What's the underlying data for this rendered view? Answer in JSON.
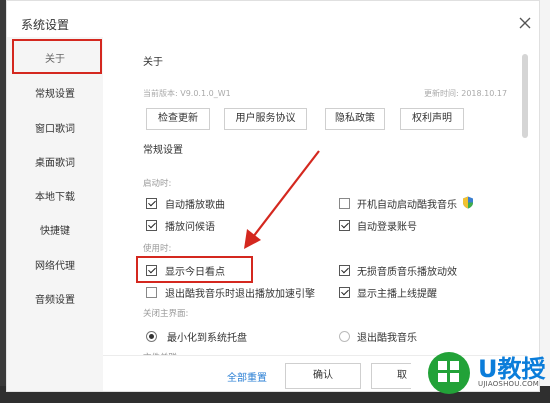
{
  "window": {
    "title": "系统设置",
    "close_icon": "close-icon"
  },
  "sidebar": {
    "items": [
      {
        "label": "关于",
        "active": true
      },
      {
        "label": "常规设置"
      },
      {
        "label": "窗口歌词"
      },
      {
        "label": "桌面歌词"
      },
      {
        "label": "本地下载"
      },
      {
        "label": "快捷键"
      },
      {
        "label": "网络代理"
      },
      {
        "label": "音频设置"
      }
    ]
  },
  "about": {
    "title": "关于",
    "version": "当前版本: V9.0.1.0_W1",
    "update_time": "更新时间: 2018.10.17",
    "buttons": [
      "检查更新",
      "用户服务协议",
      "隐私政策",
      "权利声明"
    ]
  },
  "general": {
    "title": "常规设置",
    "on_startup_label": "启动时:",
    "startup_options": [
      {
        "label": "自动播放歌曲",
        "checked": true
      },
      {
        "label": "开机自动启动酷我音乐",
        "checked": false,
        "shield_icon": "shield-icon"
      },
      {
        "label": "播放问候语",
        "checked": true
      },
      {
        "label": "自动登录账号",
        "checked": true
      }
    ],
    "in_use_label": "使用时:",
    "usage_options": [
      {
        "label": "显示今日看点",
        "checked": true
      },
      {
        "label": "无损音质音乐播放动效",
        "checked": true
      },
      {
        "label": "退出酷我音乐时退出播放加速引擎",
        "checked": false
      },
      {
        "label": "显示主播上线提醒",
        "checked": true
      }
    ],
    "close_main_label": "关闭主界面:",
    "close_options": [
      {
        "label": "最小化到系统托盘",
        "selected": true
      },
      {
        "label": "退出酷我音乐",
        "selected": false
      }
    ],
    "cut_label": "文件关联:"
  },
  "footer": {
    "reset_all": "全部重置",
    "confirm": "确认",
    "cancel_partial": "取"
  },
  "watermark": {
    "brand": "U教授",
    "site": "UJIAOSHOU.COM"
  },
  "colors": {
    "annotation_red": "#d4281f",
    "link_blue": "#2a7fd4",
    "logo_blue": "#0b7dda",
    "logo_green": "#22a238"
  }
}
